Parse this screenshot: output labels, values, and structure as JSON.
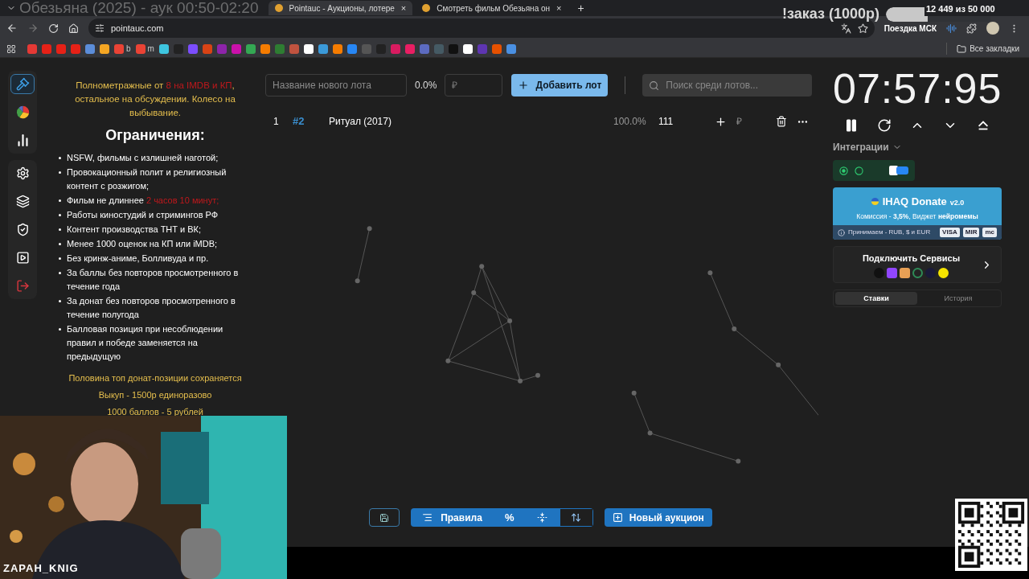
{
  "stream_overlay": {
    "title": "Обезьяна (2025) - аук 00:50-02:20",
    "order_label": "!заказ (1000р)",
    "goal": {
      "level": 0.4,
      "reading": "12 449  из 50 000",
      "name": "Поездка МСК"
    },
    "streamer": "ZAPAH_KNIG"
  },
  "browser": {
    "tabs": [
      {
        "title": "Pointauc - Аукционы, лотере",
        "close": "×",
        "selected": true
      },
      {
        "title": "Смотреть фильм Обезьяна он",
        "close": "×",
        "selected": false
      }
    ],
    "new_tab": "+",
    "url": "pointauc.com",
    "bookmark_labels": [
      "b",
      "m"
    ],
    "all_bookmarks": "Все закладки"
  },
  "sidebar": {
    "groups": [
      {
        "items": [
          {
            "kind": "auction",
            "selected": true
          },
          {
            "kind": "wheel",
            "selected": false
          },
          {
            "kind": "stats",
            "selected": false
          }
        ]
      },
      {
        "items": [
          {
            "kind": "settings",
            "selected": false
          },
          {
            "kind": "layers",
            "selected": false
          },
          {
            "kind": "shield",
            "selected": false
          },
          {
            "kind": "video",
            "selected": false
          },
          {
            "kind": "logout",
            "selected": false
          }
        ]
      }
    ]
  },
  "rules": {
    "intro": [
      {
        "text": "Полнометражные от ",
        "kind": "normal"
      },
      {
        "text": "8 на IMDB и КП",
        "kind": "alert"
      },
      {
        "text": ", остальное на обсуждении. Колесо на выбывание.",
        "kind": "normal"
      }
    ],
    "heading": "Ограничения:",
    "items": [
      {
        "segments": [
          {
            "text": "NSFW, фильмы с излишней наготой;",
            "kind": "normal"
          }
        ]
      },
      {
        "segments": [
          {
            "text": "Провокационный полит и религиозный контент с розжигом;",
            "kind": "normal"
          }
        ]
      },
      {
        "segments": [
          {
            "text": "Фильм не длиннее ",
            "kind": "normal"
          },
          {
            "text": "2 часов 10 минут;",
            "kind": "alert"
          }
        ]
      },
      {
        "segments": [
          {
            "text": "Работы киностудий и стримингов РФ",
            "kind": "normal"
          }
        ]
      },
      {
        "segments": [
          {
            "text": "Контент производства ТНТ и ВК;",
            "kind": "normal"
          }
        ]
      },
      {
        "segments": [
          {
            "text": "Менее 1000 оценок на КП или iMDB;",
            "kind": "normal"
          }
        ]
      },
      {
        "segments": [
          {
            "text": "Без кринж-аниме, Болливуда и пр.",
            "kind": "normal"
          }
        ]
      },
      {
        "segments": [
          {
            "text": "За баллы без повторов просмотренного в течение года",
            "kind": "normal"
          }
        ]
      },
      {
        "segments": [
          {
            "text": "За донат без повторов просмотренного в течение полугода",
            "kind": "normal"
          }
        ]
      },
      {
        "segments": [
          {
            "text": "Балловая позиция при несоблюдении правил и победе заменяется на предыдущую",
            "kind": "normal"
          }
        ]
      }
    ],
    "footer": [
      "Половина топ донат-позиции сохраняется",
      "Выкуп - 1500р единоразово",
      "1000 баллов - 5 рублей"
    ]
  },
  "lot_form": {
    "name_placeholder": "Название нового лота",
    "percent": "0.0%",
    "amount_placeholder": "₽",
    "add_button": "Добавить лот",
    "search_placeholder": "Поиск среди лотов..."
  },
  "lots": [
    {
      "index": "1",
      "id": "#2",
      "name": "Ритуал (2017)",
      "percent": "100.0%",
      "amount": "111",
      "currency": "₽"
    }
  ],
  "timer": {
    "time": "07:57:95"
  },
  "integrations": {
    "title": "Интеграции"
  },
  "donate_card": {
    "name": "IHAQ Donate",
    "version": "v2.0",
    "commission": "Комиссия - **3,5%**, Виджет **нейромемы**",
    "accepts": "Принимаем - RUB, $ и EUR",
    "payment_badges": [
      "VISA",
      "MIR",
      "mc"
    ]
  },
  "services_card": {
    "title": "Подключить Сервисы"
  },
  "history_tabs": [
    {
      "label": "Ставки",
      "selected": true
    },
    {
      "label": "История",
      "selected": false
    }
  ],
  "bottom_toolbar": {
    "rules_button": "Правила",
    "percent_button": "%",
    "new_auction_button": "Новый аукцион"
  }
}
